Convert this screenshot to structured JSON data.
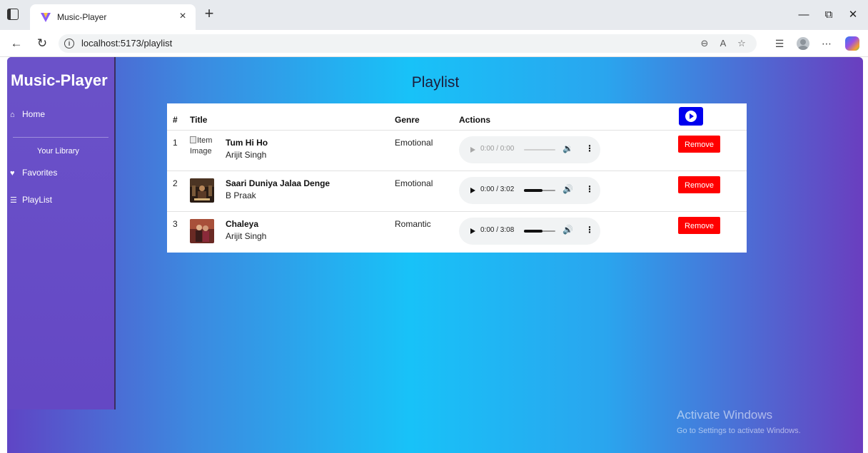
{
  "browser": {
    "tab_title": "Music-Player",
    "tab_close": "×",
    "new_tab": "+",
    "url": "localhost:5173/playlist",
    "window_controls": {
      "minimize": "—",
      "maximize": "⧉",
      "close": "✕"
    },
    "icons": [
      "sidebar-toggle-icon",
      "vite-favicon-icon",
      "back-icon",
      "refresh-icon",
      "info-icon",
      "zoom-icon",
      "read-aloud-icon",
      "favorite-star-icon",
      "favorites-bar-icon",
      "profile-icon",
      "more-icon",
      "copilot-icon"
    ],
    "read_aloud_label": "A"
  },
  "sidebar": {
    "brand": "Music-Player",
    "home_label": "Home",
    "library_label": "Your Library",
    "favorites_label": "Favorites",
    "playlist_label": "PlayList"
  },
  "page": {
    "title": "Playlist"
  },
  "table": {
    "columns": {
      "num": "#",
      "title": "Title",
      "genre": "Genre",
      "actions": "Actions"
    },
    "rows": [
      {
        "num": "1",
        "image_alt_1": "Item",
        "image_alt_2": "Image",
        "title": "Tum Hi Ho",
        "artist": "Arijit Singh",
        "genre": "Emotional",
        "time": "0:00 / 0:00",
        "progress": 0,
        "player_disabled": true,
        "remove_label": "Remove"
      },
      {
        "num": "2",
        "title": "Saari Duniya Jalaa Denge",
        "artist": "B Praak",
        "genre": "Emotional",
        "time": "0:00 / 3:02",
        "progress": 0.6,
        "player_disabled": false,
        "remove_label": "Remove"
      },
      {
        "num": "3",
        "title": "Chaleya",
        "artist": "Arijit Singh",
        "genre": "Romantic",
        "time": "0:00 / 3:08",
        "progress": 0.6,
        "player_disabled": false,
        "remove_label": "Remove"
      }
    ]
  },
  "watermark": {
    "line1": "Activate Windows",
    "line2": "Go to Settings to activate Windows."
  },
  "colors": {
    "accent_blue": "#0000ee",
    "remove_red": "#ff0000",
    "sidebar_purple": "#6b52c9",
    "bg_cyan": "#18c2f8"
  }
}
